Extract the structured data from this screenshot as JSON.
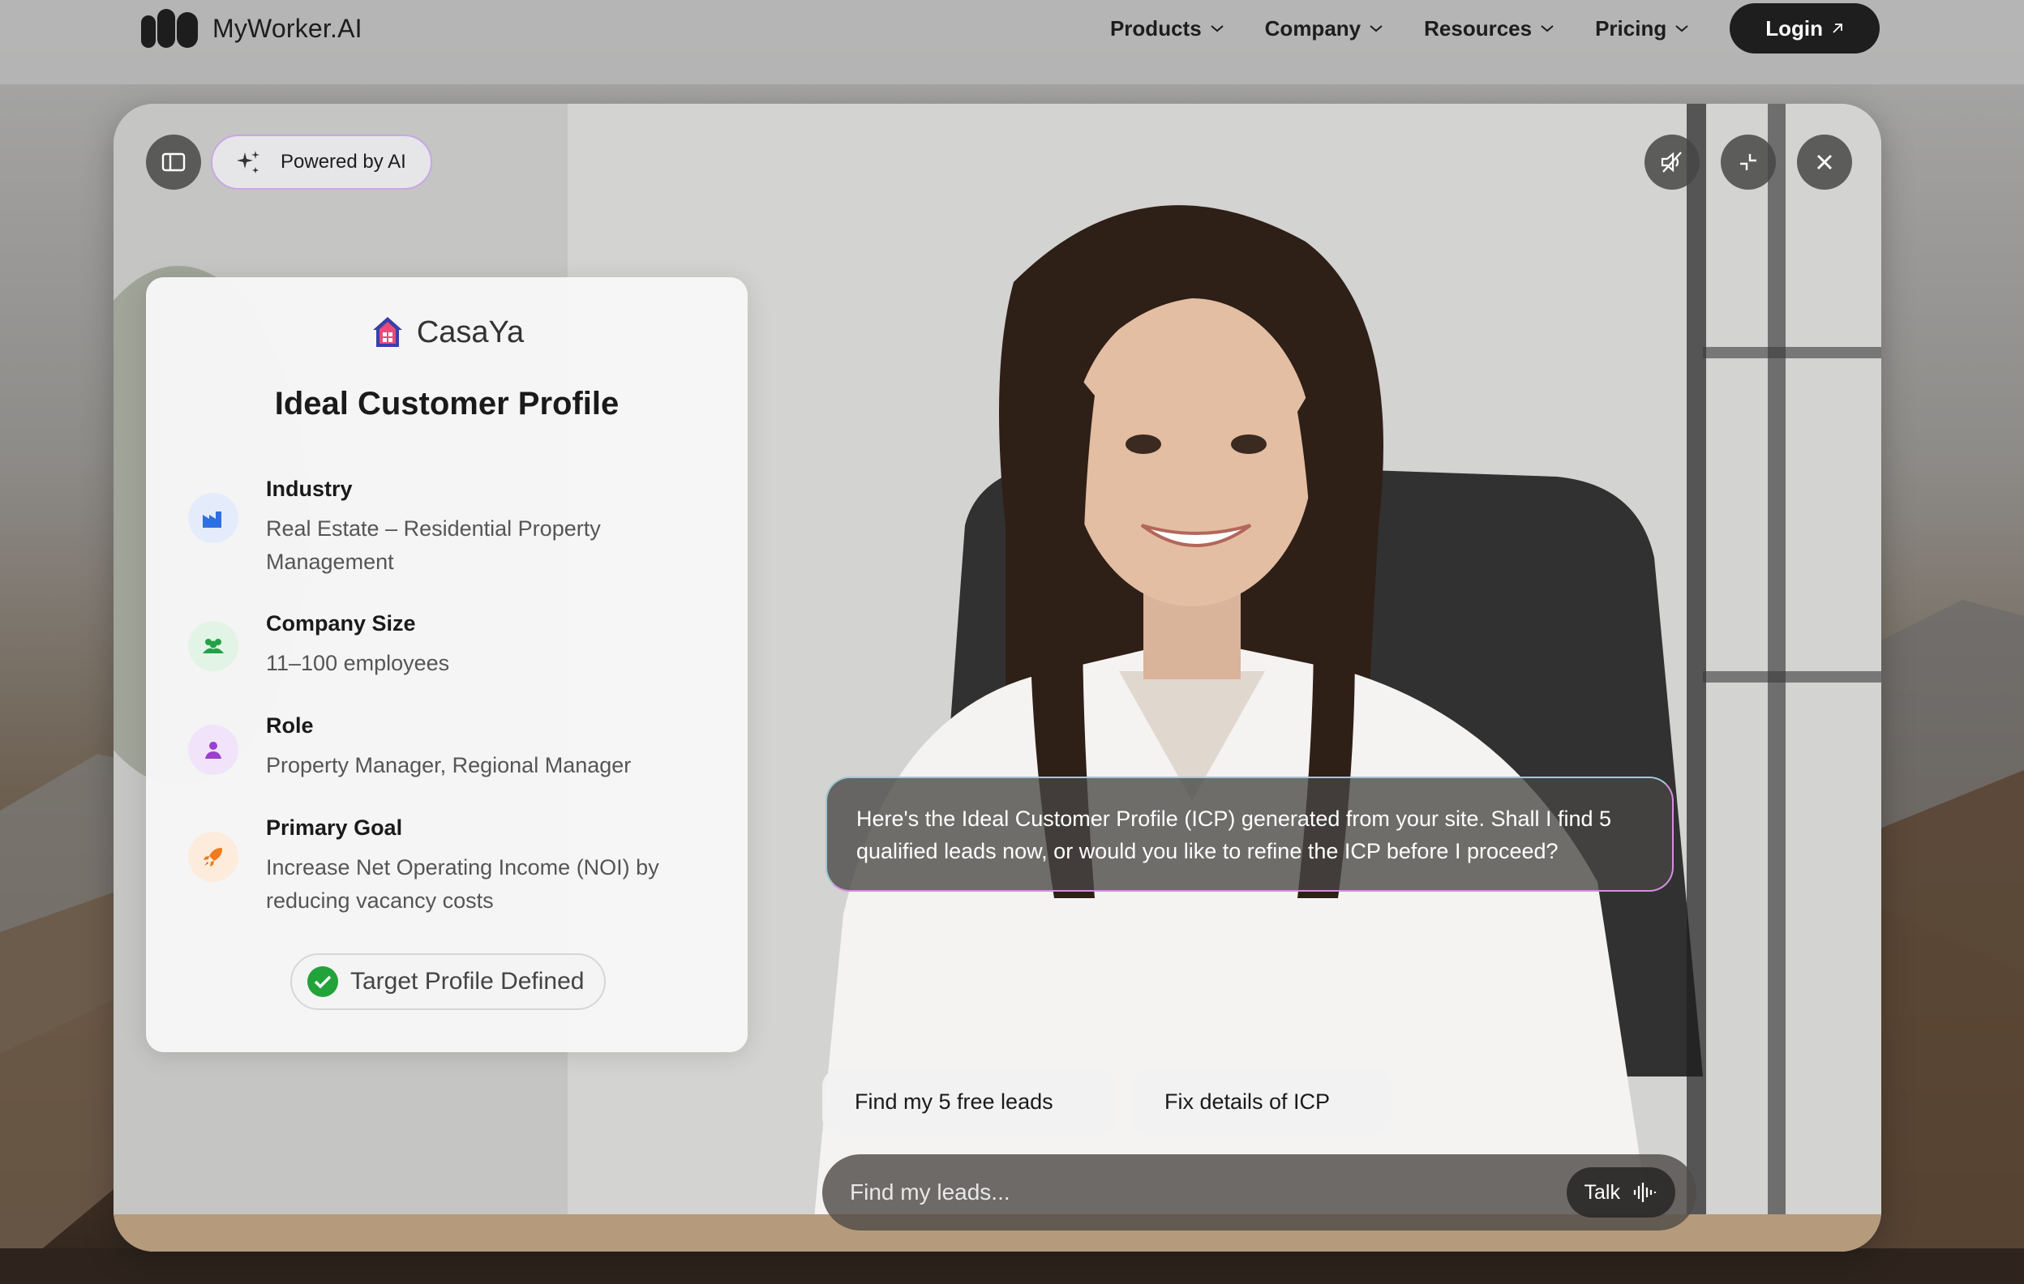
{
  "nav": {
    "brand": "MyWorker.AI",
    "items": [
      {
        "label": "Products",
        "icon": "chevron-down-icon"
      },
      {
        "label": "Company",
        "icon": "chevron-down-icon"
      },
      {
        "label": "Resources",
        "icon": "chevron-down-icon"
      },
      {
        "label": "Pricing",
        "icon": "chevron-down-icon"
      }
    ],
    "login_label": "Login"
  },
  "toolbar": {
    "powered_label": "Powered by AI",
    "icons": [
      "sidebar-toggle-icon",
      "sparkle-icon",
      "mute-icon",
      "minimize-icon",
      "close-icon"
    ]
  },
  "icp": {
    "brand": "CasaYa",
    "title": "Ideal Customer Profile",
    "fields": [
      {
        "label": "Industry",
        "value": "Real Estate – Residential Property Management",
        "icon": "factory-icon",
        "color": "#2f6fe4"
      },
      {
        "label": "Company Size",
        "value": "11–100 employees",
        "icon": "people-icon",
        "color": "#24a148"
      },
      {
        "label": "Role",
        "value": "Property Manager, Regional Manager",
        "icon": "person-icon",
        "color": "#9a3fd1"
      },
      {
        "label": "Primary Goal",
        "value": "Increase Net Operating Income (NOI) by reducing vacancy costs",
        "icon": "rocket-icon",
        "color": "#f07a1f"
      }
    ],
    "badge_label": "Target Profile Defined"
  },
  "chat": {
    "message": "Here's the Ideal Customer Profile (ICP) generated from your site. Shall I find 5 qualified leads now, or would you like to refine the ICP before I proceed?",
    "suggestions": [
      "Find my 5 free leads",
      "Fix details of ICP"
    ],
    "input_placeholder": "Find my leads...",
    "talk_label": "Talk"
  },
  "colors": {
    "accent_dark": "#1e1e1e",
    "ai_border": "#c9a6e6",
    "success": "#22a33a"
  }
}
